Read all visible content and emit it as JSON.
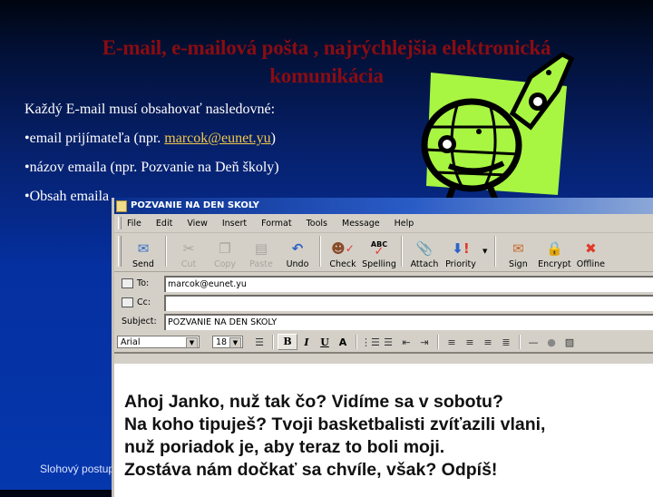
{
  "slide": {
    "title_line1": "E-mail, e-mailová pošta , najrýchlejšia elektronická",
    "title_line2": "komunikácia",
    "intro": "Každý E-mail musí obsahovať nasledovné:",
    "bullets": [
      {
        "prefix": "•email prijímateľa (npr. ",
        "link": "marcok@eunet.yu",
        "suffix": ")"
      },
      {
        "text": "•názov emaila (npr. Pozvanie na Deň školy)"
      },
      {
        "text": "•Obsah emaila"
      }
    ],
    "footer": "Slohový postup",
    "colors": {
      "title": "#8a0c12",
      "link": "#f2c94c",
      "clipart_green": "#a8f542"
    }
  },
  "window": {
    "title": "POZVANIE NA DEN SKOLY",
    "menu": [
      "File",
      "Edit",
      "View",
      "Insert",
      "Format",
      "Tools",
      "Message",
      "Help"
    ],
    "toolbar": [
      {
        "label": "Send",
        "icon": "send-icon",
        "enabled": true
      },
      {
        "label": "Cut",
        "icon": "scissors-icon",
        "enabled": false
      },
      {
        "label": "Copy",
        "icon": "copy-icon",
        "enabled": false
      },
      {
        "label": "Paste",
        "icon": "paste-icon",
        "enabled": false
      },
      {
        "label": "Undo",
        "icon": "undo-icon",
        "enabled": true
      },
      {
        "label": "Check",
        "icon": "check-names-icon",
        "enabled": true
      },
      {
        "label": "Spelling",
        "icon": "spelling-icon",
        "enabled": true
      },
      {
        "label": "Attach",
        "icon": "paperclip-icon",
        "enabled": true
      },
      {
        "label": "Priority",
        "icon": "priority-icon",
        "enabled": true
      },
      {
        "label": "Sign",
        "icon": "sign-icon",
        "enabled": true
      },
      {
        "label": "Encrypt",
        "icon": "encrypt-icon",
        "enabled": true
      },
      {
        "label": "Offline",
        "icon": "offline-icon",
        "enabled": true
      }
    ],
    "fields": {
      "to_label": "To:",
      "to_value": "marcok@eunet.yu",
      "cc_label": "Cc:",
      "cc_value": "",
      "subject_label": "Subject:",
      "subject_value": "POZVANIE NA DEN SKOLY"
    },
    "format": {
      "font": "Arial",
      "size": "18",
      "bold": "B",
      "italic": "I",
      "underline": "U",
      "color": "A"
    },
    "message_lines": [
      "Ahoj Janko, nuž tak čo? Vidíme sa v sobotu?",
      "Na koho tipuješ? Tvoji basketbalisti zvíťazili vlani,",
      "nuž poriadok je, aby teraz to boli moji.",
      "Zostáva nám dočkať sa chvíle, však? Odpíš!"
    ]
  }
}
